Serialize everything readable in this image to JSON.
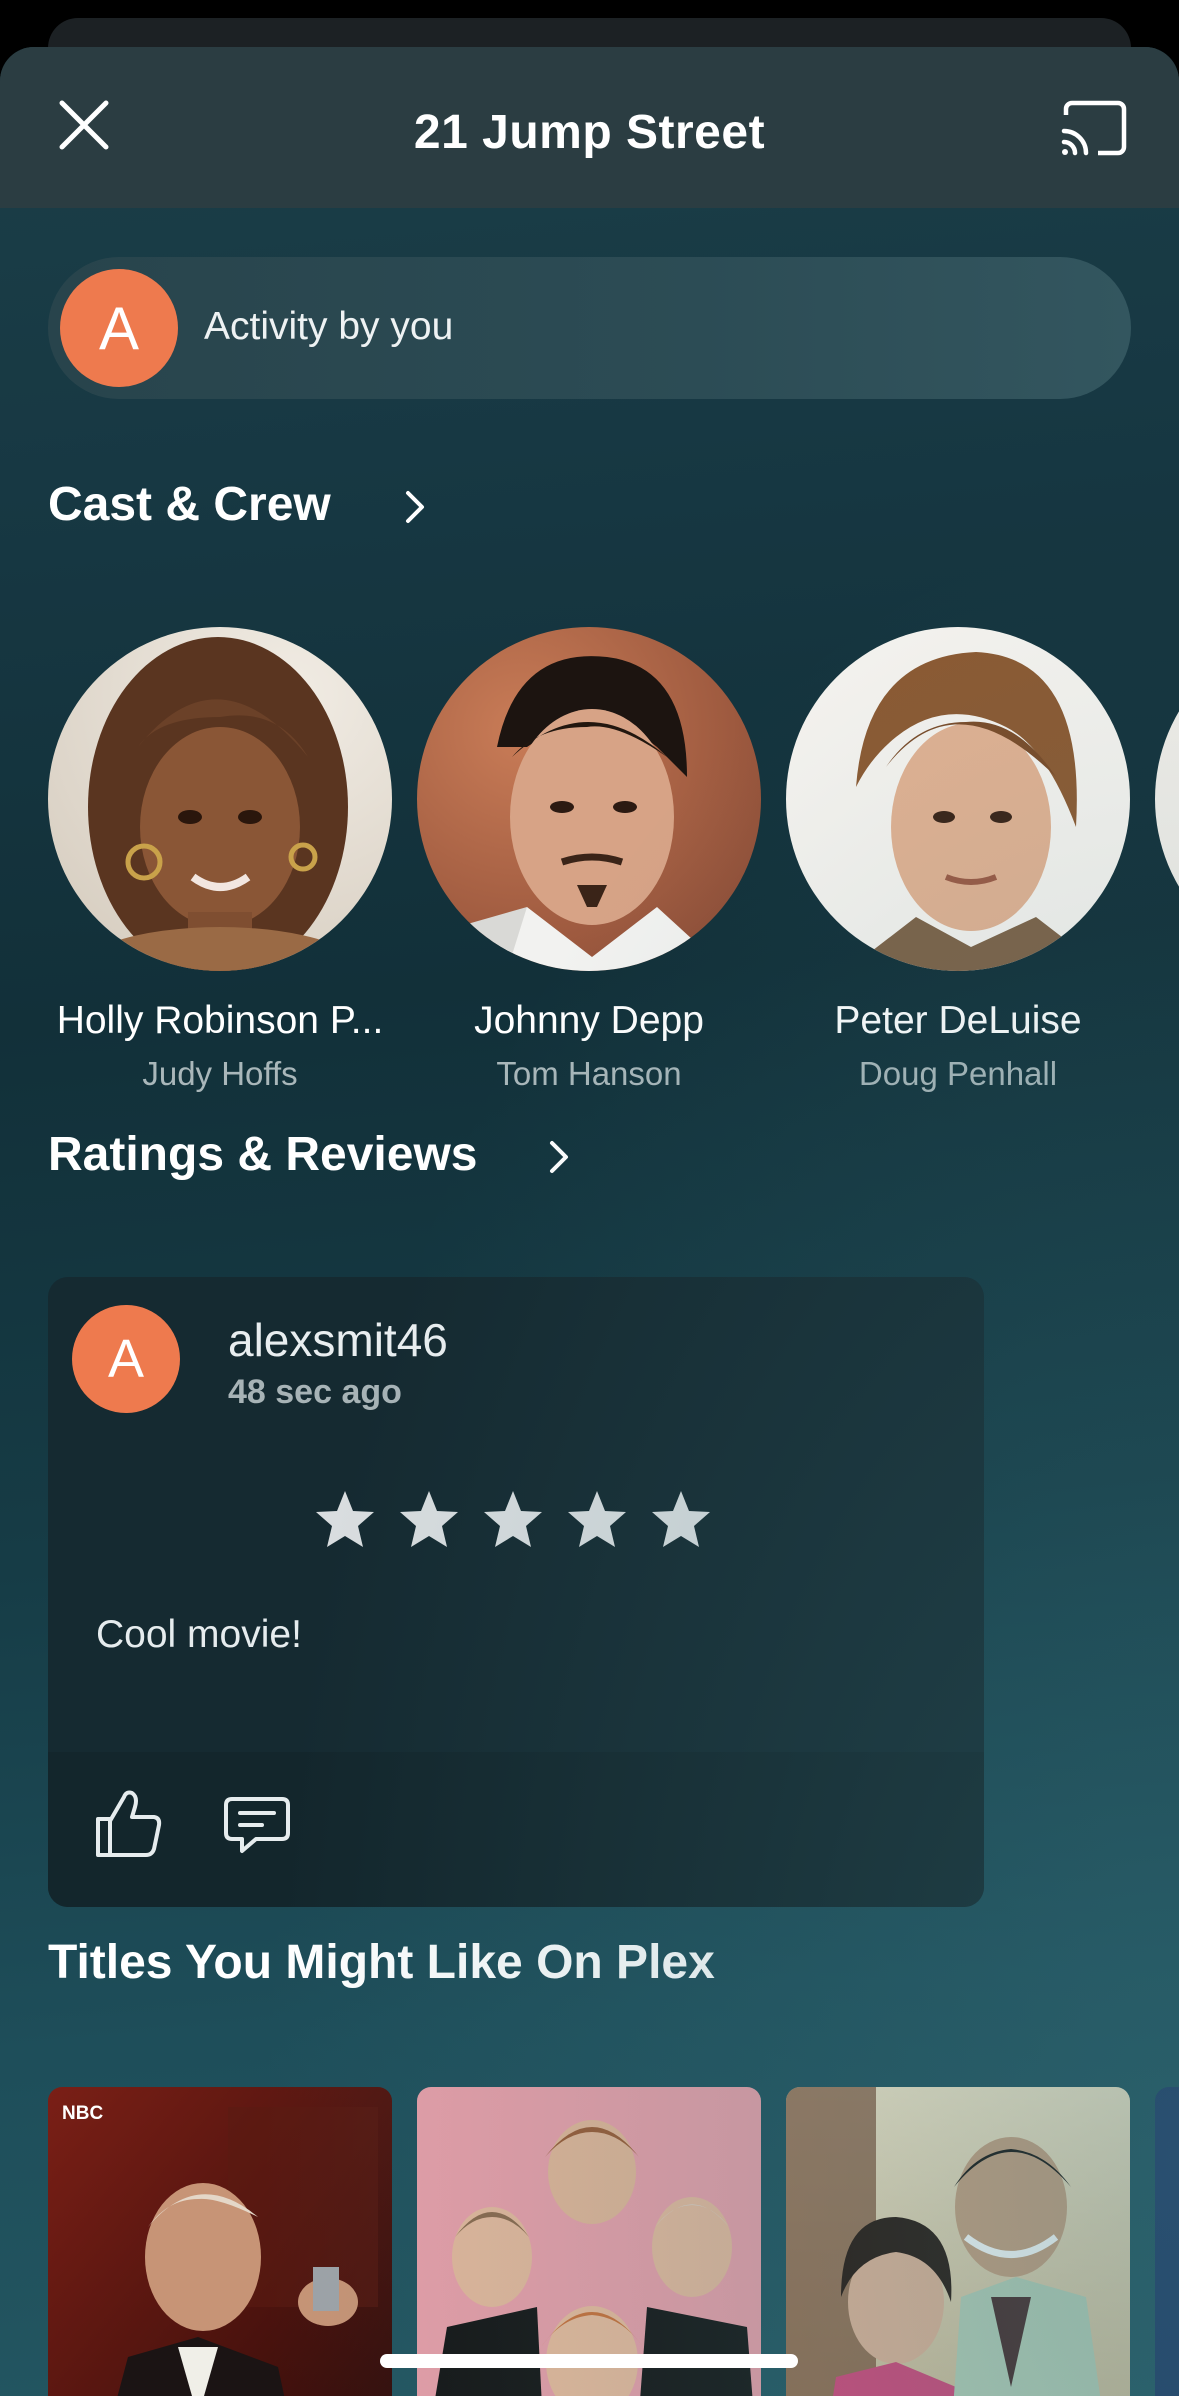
{
  "header": {
    "title": "21 Jump Street",
    "close_icon": "close-icon",
    "cast_icon": "cast-icon"
  },
  "activity": {
    "avatar_initial": "A",
    "label": "Activity by you",
    "avatar_color": "#ee7a4e"
  },
  "cast_section": {
    "title": "Cast & Crew",
    "members": [
      {
        "name": "Holly Robinson P...",
        "role": "Judy Hoffs"
      },
      {
        "name": "Johnny Depp",
        "role": "Tom Hanson"
      },
      {
        "name": "Peter DeLuise",
        "role": "Doug Penhall"
      }
    ]
  },
  "reviews_section": {
    "title": "Ratings & Reviews",
    "review": {
      "avatar_initial": "A",
      "username": "alexsmit46",
      "time": "48 sec ago",
      "rating": 5,
      "max_rating": 5,
      "text": "Cool movie!"
    }
  },
  "suggestions_section": {
    "title": "Titles You Might Like On Plex",
    "posters": [
      {
        "badge": "NBC"
      },
      {
        "badge": ""
      },
      {
        "badge": ""
      }
    ]
  }
}
